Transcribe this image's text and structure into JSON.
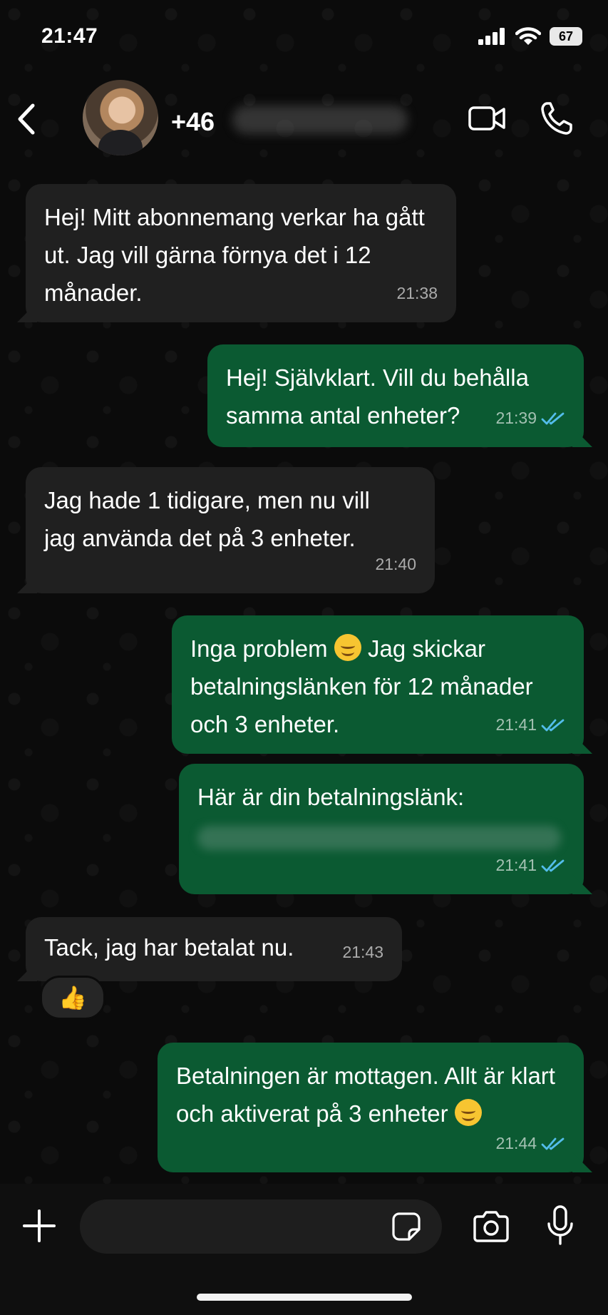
{
  "status_bar": {
    "time": "21:47",
    "battery": "67"
  },
  "header": {
    "contact_prefix": "+46"
  },
  "messages": [
    {
      "direction": "incoming",
      "text": "Hej! Mitt abonnemang verkar ha gått ut. Jag vill gärna förnya det i 12 månader.",
      "time": "21:38"
    },
    {
      "direction": "outgoing",
      "text": "Hej! Självklart. Vill du behålla samma antal enheter?",
      "time": "21:39",
      "read": true
    },
    {
      "direction": "incoming",
      "text": "Jag hade 1 tidigare, men nu vill jag använda det på 3 enheter.",
      "time": "21:40"
    },
    {
      "direction": "outgoing",
      "text_before_emoji": "Inga problem ",
      "emoji": "smiling-face",
      "text_after_emoji": " Jag skickar betalningslänken för 12 månader och 3 enheter.",
      "time": "21:41",
      "read": true
    },
    {
      "direction": "outgoing",
      "text": "Här är din betalningslänk:",
      "time": "21:41",
      "read": true
    },
    {
      "direction": "incoming",
      "text": "Tack, jag har betalat nu.",
      "time": "21:43",
      "reaction": "👍"
    },
    {
      "direction": "outgoing",
      "text_before_emoji": "Betalningen är mottagen. Allt är klart och aktiverat på 3 enheter ",
      "emoji": "smiling-face",
      "time": "21:44",
      "read": true
    }
  ],
  "composer": {
    "placeholder": ""
  },
  "colors": {
    "incoming_bubble": "#202020",
    "outgoing_bubble": "#0b5a32",
    "read_ticks": "#53bdeb"
  }
}
